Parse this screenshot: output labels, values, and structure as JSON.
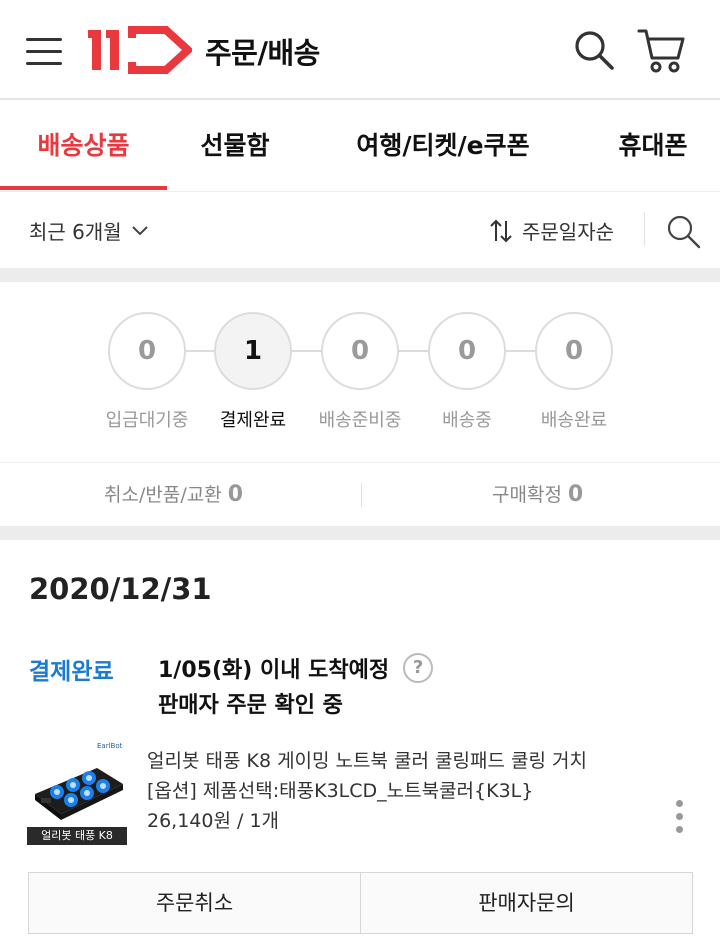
{
  "header": {
    "logo_text": "11",
    "title": "주문/배송",
    "brand_color": "#e9393f"
  },
  "tabs": [
    {
      "label": "배송상품",
      "active": true
    },
    {
      "label": "선물함",
      "active": false
    },
    {
      "label": "여행/티켓/e쿠폰",
      "active": false
    },
    {
      "label": "휴대폰",
      "active": false
    }
  ],
  "filter": {
    "period": "최근 6개월",
    "sort": "주문일자순"
  },
  "steps": [
    {
      "count": "0",
      "label": "입금대기중",
      "active": false
    },
    {
      "count": "1",
      "label": "결제완료",
      "active": true
    },
    {
      "count": "0",
      "label": "배송준비중",
      "active": false
    },
    {
      "count": "0",
      "label": "배송중",
      "active": false
    },
    {
      "count": "0",
      "label": "배송완료",
      "active": false
    }
  ],
  "summary": {
    "cancel_label": "취소/반품/교환",
    "cancel_count": "0",
    "confirm_label": "구매확정",
    "confirm_count": "0"
  },
  "order": {
    "date": "2020/12/31",
    "status": "결제완료",
    "status_color": "#1a7bd1",
    "delivery": "1/05(화) 이내 도착예정",
    "help": "?",
    "seller_status": "판매자 주문 확인 중",
    "product": {
      "thumb_brand": "EarlBot",
      "thumb_caption": "얼리봇 태풍 K8",
      "name": "얼리봇 태풍 K8 게이밍 노트북 쿨러 쿨링패드 쿨링 거치",
      "option": "[옵션] 제품선택:태풍K3LCD_노트북쿨러{K3L}",
      "price": "26,140원 / 1개"
    },
    "buttons": {
      "cancel": "주문취소",
      "inquiry": "판매자문의"
    }
  }
}
